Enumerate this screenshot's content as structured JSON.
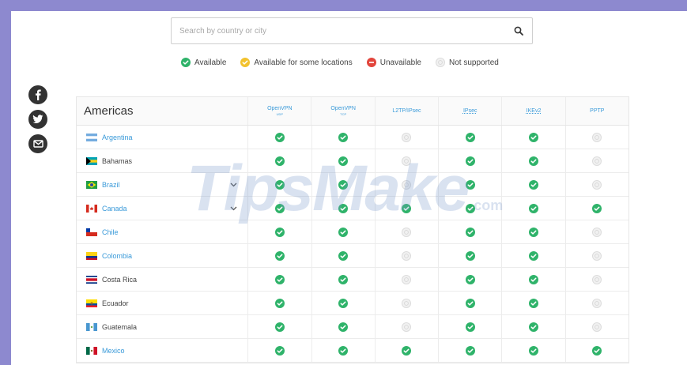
{
  "search": {
    "placeholder": "Search by country or city",
    "icon": "search-icon"
  },
  "legend": [
    {
      "label": "Available",
      "color": "#2fb36a",
      "kind": "green"
    },
    {
      "label": "Available for some locations",
      "color": "#f2c22e",
      "kind": "yellow"
    },
    {
      "label": "Unavailable",
      "color": "#e2453c",
      "kind": "red"
    },
    {
      "label": "Not supported",
      "color": "#e3e3e3",
      "kind": "grey"
    }
  ],
  "social": [
    {
      "icon": "facebook-icon"
    },
    {
      "icon": "twitter-icon"
    },
    {
      "icon": "email-icon"
    }
  ],
  "table": {
    "region": "Americas",
    "columns": [
      {
        "label": "OpenVPN",
        "sub": "UDP"
      },
      {
        "label": "OpenVPN",
        "sub": "TCP"
      },
      {
        "label": "L2TP/IPsec",
        "sub": ""
      },
      {
        "label": "IPsec",
        "sub": ""
      },
      {
        "label": "IKEv2",
        "sub": ""
      },
      {
        "label": "PPTP",
        "sub": ""
      }
    ],
    "rows": [
      {
        "name": "Argentina",
        "link": true,
        "flag": "argentina",
        "expand": false,
        "status": [
          "available",
          "available",
          "unsupported",
          "available",
          "available",
          "unsupported"
        ]
      },
      {
        "name": "Bahamas",
        "link": false,
        "flag": "bahamas",
        "expand": false,
        "status": [
          "available",
          "available",
          "unsupported",
          "available",
          "available",
          "unsupported"
        ]
      },
      {
        "name": "Brazil",
        "link": true,
        "flag": "brazil",
        "expand": true,
        "status": [
          "available",
          "available",
          "unsupported",
          "available",
          "available",
          "unsupported"
        ]
      },
      {
        "name": "Canada",
        "link": true,
        "flag": "canada",
        "expand": true,
        "status": [
          "available",
          "available",
          "available",
          "available",
          "available",
          "available"
        ]
      },
      {
        "name": "Chile",
        "link": true,
        "flag": "chile",
        "expand": false,
        "status": [
          "available",
          "available",
          "unsupported",
          "available",
          "available",
          "unsupported"
        ]
      },
      {
        "name": "Colombia",
        "link": true,
        "flag": "colombia",
        "expand": false,
        "status": [
          "available",
          "available",
          "unsupported",
          "available",
          "available",
          "unsupported"
        ]
      },
      {
        "name": "Costa Rica",
        "link": false,
        "flag": "costa-rica",
        "expand": false,
        "status": [
          "available",
          "available",
          "unsupported",
          "available",
          "available",
          "unsupported"
        ]
      },
      {
        "name": "Ecuador",
        "link": false,
        "flag": "ecuador",
        "expand": false,
        "status": [
          "available",
          "available",
          "unsupported",
          "available",
          "available",
          "unsupported"
        ]
      },
      {
        "name": "Guatemala",
        "link": false,
        "flag": "guatemala",
        "expand": false,
        "status": [
          "available",
          "available",
          "unsupported",
          "available",
          "available",
          "unsupported"
        ]
      },
      {
        "name": "Mexico",
        "link": true,
        "flag": "mexico",
        "expand": false,
        "status": [
          "available",
          "available",
          "available",
          "available",
          "available",
          "available"
        ]
      }
    ]
  },
  "watermark": {
    "main": "TipsMake",
    "suffix": ".com"
  }
}
